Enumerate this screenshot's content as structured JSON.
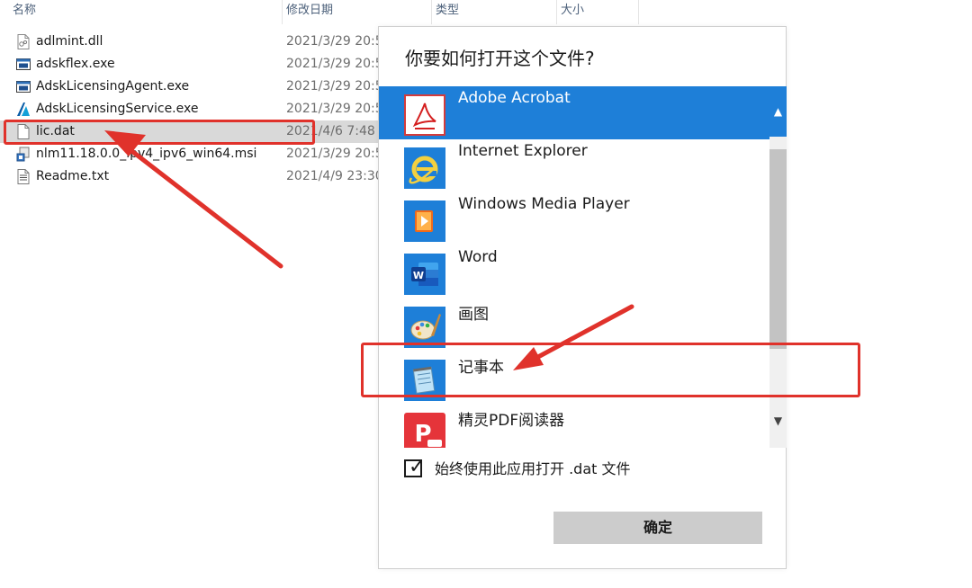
{
  "explorer": {
    "columns": {
      "name": "名称",
      "date": "修改日期",
      "type": "类型",
      "size": "大小"
    },
    "files": [
      {
        "name": "adlmint.dll",
        "date": "2021/3/29 20:5",
        "icon": "dll-file-icon"
      },
      {
        "name": "adskflex.exe",
        "date": "2021/3/29 20:5",
        "icon": "exe-window-icon"
      },
      {
        "name": "AdskLicensingAgent.exe",
        "date": "2021/3/29 20:5",
        "icon": "exe-window-icon"
      },
      {
        "name": "AdskLicensingService.exe",
        "date": "2021/3/29 20:5",
        "icon": "autodesk-logo-icon"
      },
      {
        "name": "lic.dat",
        "date": "2021/4/6 7:48",
        "icon": "blank-file-icon",
        "selected": true
      },
      {
        "name": "nlm11.18.0.0_ipv4_ipv6_win64.msi",
        "date": "2021/3/29 20:5",
        "icon": "msi-installer-icon"
      },
      {
        "name": "Readme.txt",
        "date": "2021/4/9 23:30",
        "icon": "text-file-icon"
      }
    ]
  },
  "dialog": {
    "title": "你要如何打开这个文件?",
    "apps": [
      {
        "label": "Adobe Acrobat",
        "icon": "adobe-acrobat-icon",
        "selected": true
      },
      {
        "label": "Internet Explorer",
        "icon": "internet-explorer-icon"
      },
      {
        "label": "Windows Media Player",
        "icon": "windows-media-player-icon"
      },
      {
        "label": "Word",
        "icon": "word-icon"
      },
      {
        "label": "画图",
        "icon": "paint-icon"
      },
      {
        "label": "记事本",
        "icon": "notepad-icon"
      },
      {
        "label": "精灵PDF阅读器",
        "icon": "pdf-reader-icon"
      }
    ],
    "always_use_label": "始终使用此应用打开 .dat 文件",
    "always_use_checked": true,
    "ok_label": "确定"
  },
  "colors": {
    "accent": "#1e7fd8",
    "annotation": "#e0322b",
    "selection": "#d9d9d9"
  }
}
